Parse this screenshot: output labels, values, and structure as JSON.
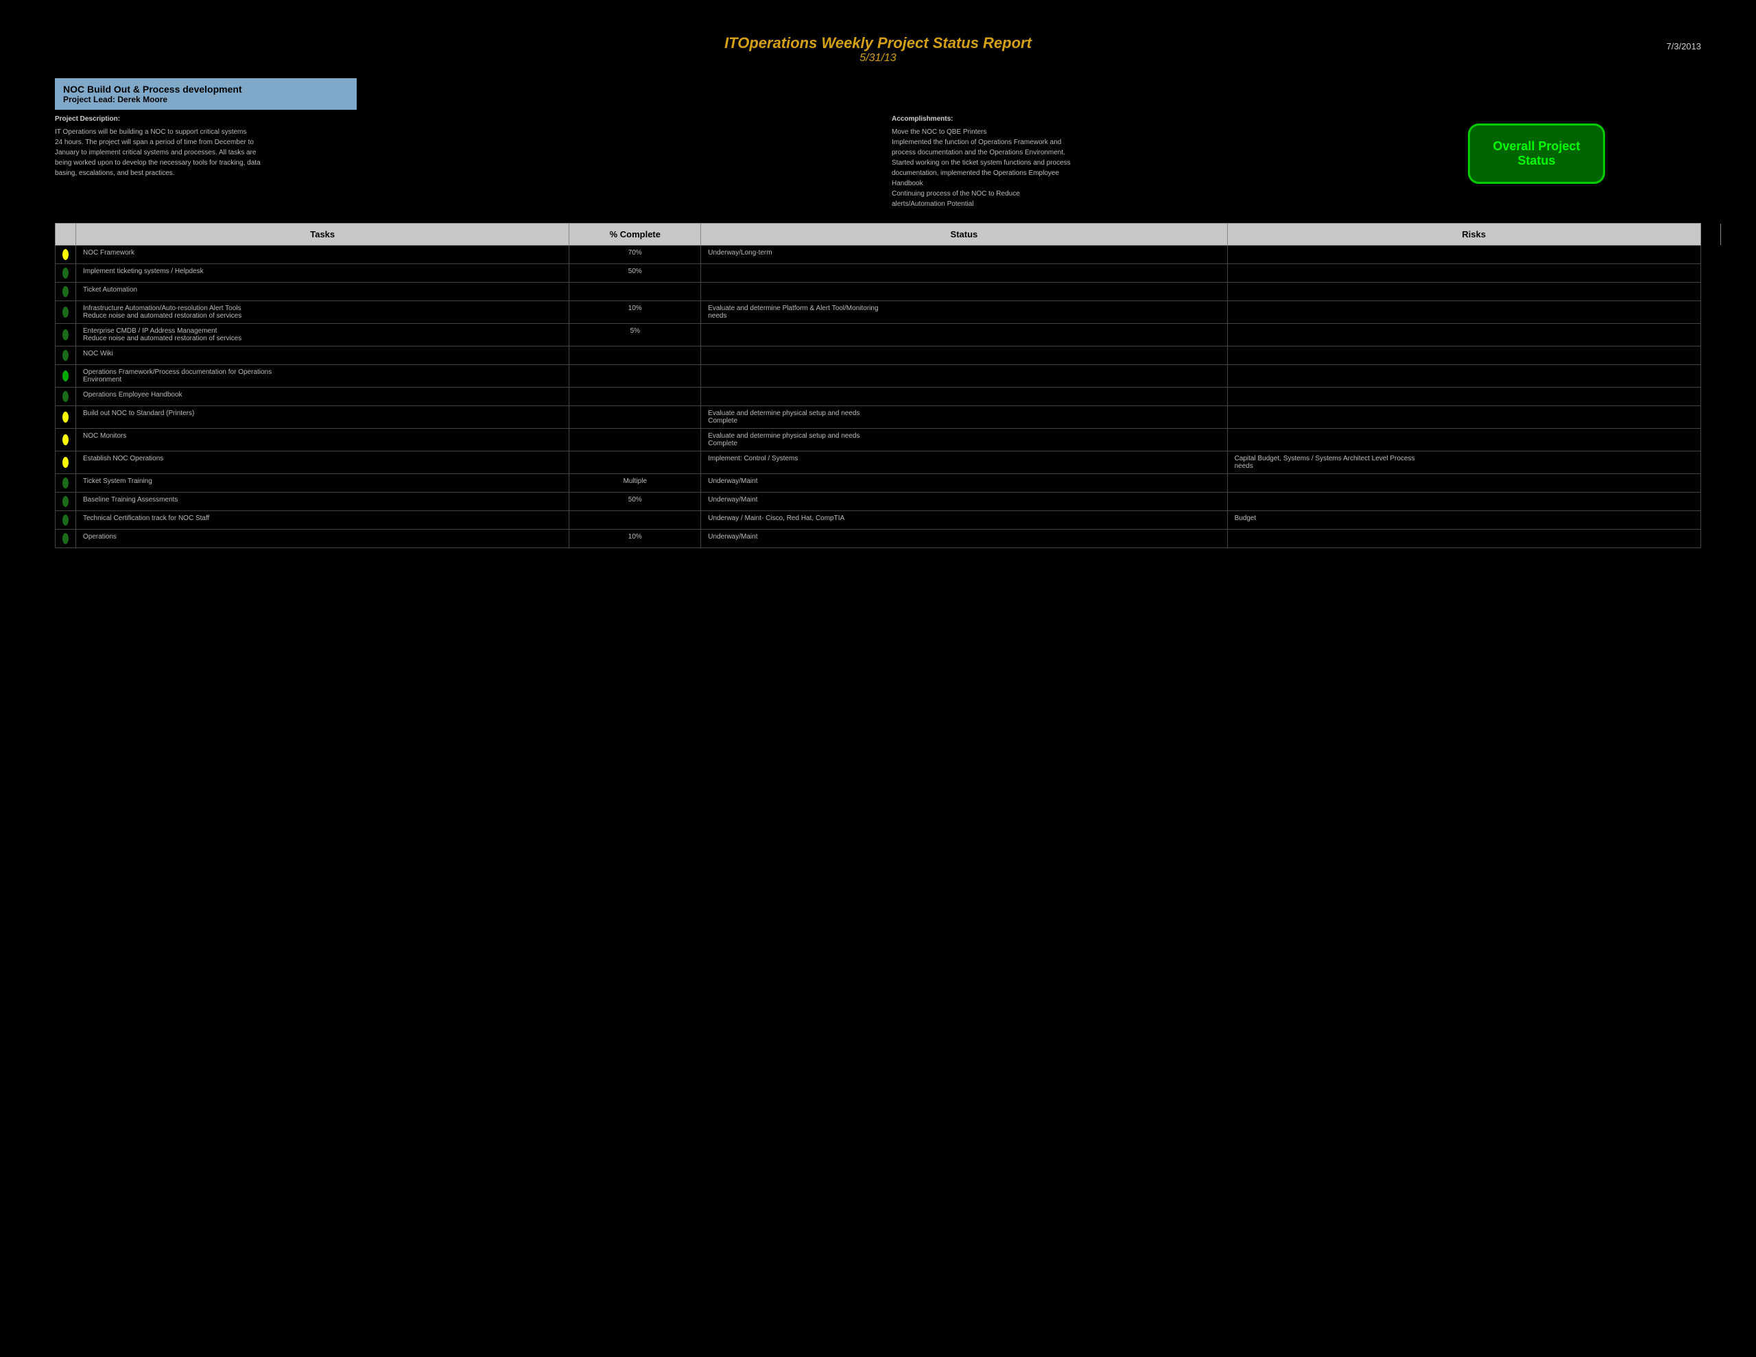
{
  "header": {
    "title": "ITOperations Weekly Project Status Report",
    "subtitle": "5/31/13",
    "date": "7/3/2013"
  },
  "project": {
    "title": "NOC Build Out & Process development",
    "lead_label": "Project Lead:",
    "lead_name": "Derek Moore"
  },
  "overall_status": {
    "label": "Overall Project Status"
  },
  "description": {
    "label": "Project Description:",
    "text": "IT Operations will be building a NOC to support critical systems\r\n24 hours. The project will span a period of time from December to\r\nJanuary to implement critical systems and processes. All tasks are\r\nbeing worked upon to develop the necessary tools for tracking, data\r\nbasing, escalations, and best practices."
  },
  "accomplishments": {
    "label": "Accomplishments:",
    "text": "Move the NOC to QBE Printers\r\nImplemented the function of Operations Framework and\r\nprocess documentation and the Operations Environment.\r\nStarted working on the ticket system functions and process\r\ndocumentation, implemented the Operations Employee\r\nHandbook\r\nContinuing process of the NOC to Reduce\r\nalerts/Automation Potential"
  },
  "table": {
    "headers": [
      "",
      "Tasks",
      "% Complete",
      "Status",
      "Risks"
    ],
    "rows": [
      {
        "indicator": "yellow",
        "task": "NOC Framework",
        "complete": "70%",
        "status": "Underway/Long-term",
        "risks": ""
      },
      {
        "indicator": "dkgreen",
        "task": "Implement ticketing systems / Helpdesk",
        "complete": "50%",
        "status": "",
        "risks": ""
      },
      {
        "indicator": "dkgreen",
        "task": "Ticket Automation",
        "complete": "",
        "status": "",
        "risks": ""
      },
      {
        "indicator": "dkgreen",
        "task": "Infrastructure Automation/Auto-resolution Alert Tools\r\nReduce noise and automated restoration of services",
        "complete": "10%",
        "status": "Evaluate and determine Platform & Alert Tool/Monitoring\r\nneeds",
        "risks": ""
      },
      {
        "indicator": "dkgreen",
        "task": "Enterprise CMDB / IP Address Management\r\nReduce noise and automated restoration of services",
        "complete": "5%",
        "status": "",
        "risks": ""
      },
      {
        "indicator": "dkgreen",
        "task": "NOC Wiki",
        "complete": "",
        "status": "",
        "risks": ""
      },
      {
        "indicator": "brgreen",
        "task": "Operations Framework/Process documentation for Operations\r\nEnvironment",
        "complete": "",
        "status": "",
        "risks": ""
      },
      {
        "indicator": "dkgreen",
        "task": "Operations Employee Handbook",
        "complete": "",
        "status": "",
        "risks": ""
      },
      {
        "indicator": "yellow",
        "task": "Build out NOC to Standard (Printers)",
        "complete": "",
        "status": "Evaluate and determine physical setup and needs\r\nComplete",
        "risks": ""
      },
      {
        "indicator": "yellow",
        "task": "NOC Monitors",
        "complete": "",
        "status": "Evaluate and determine physical setup and needs\r\nComplete",
        "risks": ""
      },
      {
        "indicator": "yellow",
        "task": "Establish NOC Operations",
        "complete": "",
        "status": "Implement: Control / Systems",
        "risks": "Capital Budget, Systems / Systems Architect Level Process\r\nneeds"
      },
      {
        "indicator": "dkgreen",
        "task": "Ticket System Training",
        "complete": "Multiple",
        "status": "Underway/Maint",
        "risks": ""
      },
      {
        "indicator": "dkgreen",
        "task": "Baseline Training Assessments",
        "complete": "50%",
        "status": "Underway/Maint",
        "risks": ""
      },
      {
        "indicator": "dkgreen",
        "task": "Technical Certification track for NOC Staff",
        "complete": "",
        "status": "Underway / Maint- Cisco, Red Hat, CompTIA",
        "risks": "Budget"
      },
      {
        "indicator": "dkgreen",
        "task": "Operations",
        "complete": "10%",
        "status": "Underway/Maint",
        "risks": ""
      }
    ]
  }
}
